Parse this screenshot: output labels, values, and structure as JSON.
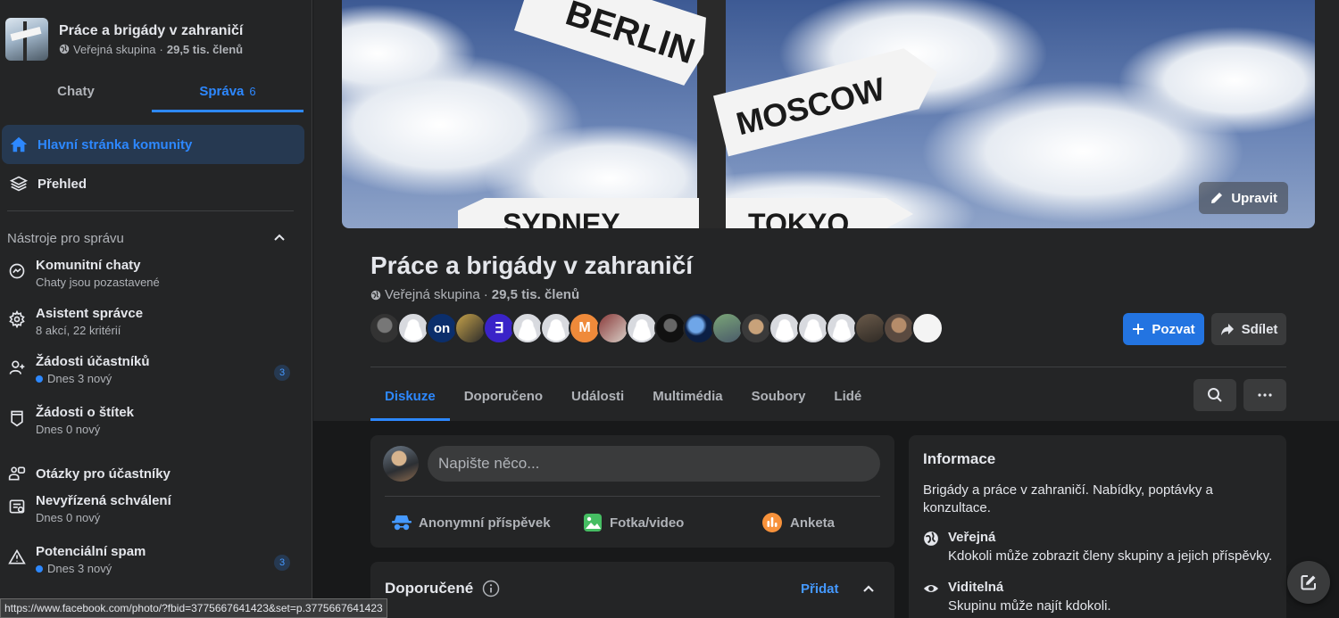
{
  "group": {
    "name": "Práce a brigády v zahraničí",
    "privacy": "Veřejná skupina",
    "dot": "·",
    "members": "29,5 tis. členů"
  },
  "sidebar": {
    "tabs": [
      {
        "label": "Chaty"
      },
      {
        "label": "Správa",
        "count": "6"
      }
    ],
    "nav": [
      {
        "label": "Hlavní stránka komunity",
        "icon": "home-icon"
      },
      {
        "label": "Přehled",
        "icon": "layers-icon"
      }
    ],
    "tools_header": "Nástroje pro správu",
    "tools": [
      {
        "title": "Komunitní chaty",
        "sub": "Chaty jsou pozastavené",
        "icon": "messenger-icon"
      },
      {
        "title": "Asistent správce",
        "sub": "8 akcí, 22 kritérií",
        "icon": "gear-icon"
      },
      {
        "title": "Žádosti účastníků",
        "sub": "Dnes 3 nový",
        "icon": "add-person-icon",
        "badge": "3"
      },
      {
        "title": "Žádosti o štítek",
        "sub": "Dnes 0 nový",
        "icon": "tag-icon"
      },
      {
        "title": "Otázky pro účastníky",
        "sub": "",
        "icon": "questions-icon"
      },
      {
        "title": "Nevyřízená schválení",
        "sub": "Dnes 0 nový",
        "icon": "pending-icon"
      },
      {
        "title": "Potenciální spam",
        "sub": "Dnes 3 nový",
        "icon": "warning-icon",
        "badge": "3"
      }
    ]
  },
  "status_url": "https://www.facebook.com/photo/?fbid=3775667641423&set=p.3775667641423",
  "cover": {
    "edit_label": "Upravit",
    "signs": [
      "BERLIN",
      "MOSCOW",
      "SYDNEY",
      "TOKYO"
    ]
  },
  "actions": {
    "invite": "Pozvat",
    "share": "Sdílet"
  },
  "tabs": [
    "Diskuze",
    "Doporučeno",
    "Události",
    "Multimédia",
    "Soubory",
    "Lidé"
  ],
  "composer": {
    "placeholder": "Napište něco...",
    "actions": [
      "Anonymní příspěvek",
      "Fotka/video",
      "Anketa"
    ]
  },
  "recommended": {
    "title": "Doporučené",
    "add": "Přidat"
  },
  "info": {
    "title": "Informace",
    "description": "Brigády a práce v zahraničí. Nabídky, poptávky a konzultace.",
    "rows": [
      {
        "title": "Veřejná",
        "text": "Kdokoli může zobrazit členy skupiny a jejich příspěvky."
      },
      {
        "title": "Viditelná",
        "text": "Skupinu může najít kdokoli."
      }
    ]
  },
  "colors": {
    "accent": "#2d88ff",
    "button": "#2374e1",
    "surface": "#242526",
    "background": "#18191a"
  }
}
